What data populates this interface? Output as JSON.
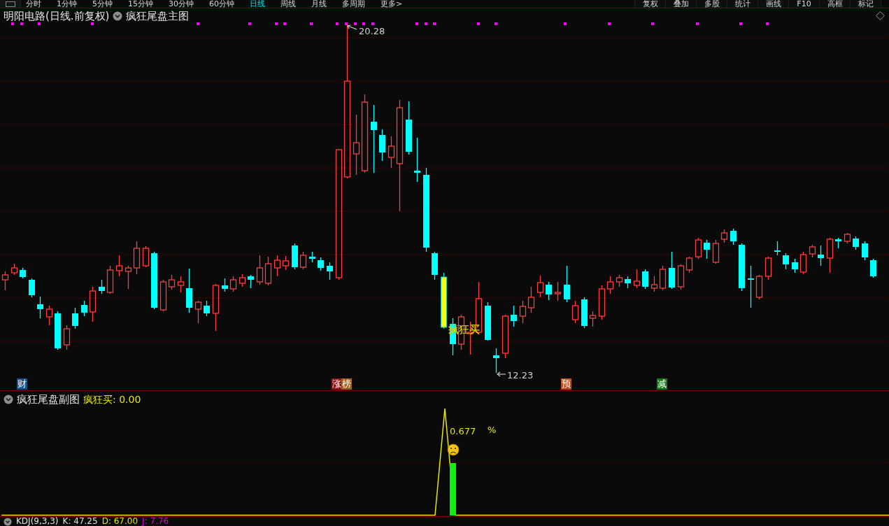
{
  "toolbar": {
    "periods": [
      {
        "label": "分时",
        "selected": false
      },
      {
        "label": "1分钟",
        "selected": false
      },
      {
        "label": "5分钟",
        "selected": false
      },
      {
        "label": "15分钟",
        "selected": false
      },
      {
        "label": "30分钟",
        "selected": false
      },
      {
        "label": "60分钟",
        "selected": false
      },
      {
        "label": "日线",
        "selected": true
      },
      {
        "label": "周线",
        "selected": false
      },
      {
        "label": "月线",
        "selected": false
      },
      {
        "label": "多周期",
        "selected": false
      },
      {
        "label": "更多>",
        "selected": false
      }
    ],
    "buttons": [
      "复权",
      "叠加",
      "多股",
      "统计",
      "画线",
      "F10",
      "高框",
      "标记"
    ]
  },
  "main_chart": {
    "title": "明阳电路(日线.前复权)",
    "indicator": "疯狂尾盘主图",
    "high_label": "20.28",
    "low_label": "12.23",
    "signal_label": "疯狂买",
    "events": [
      {
        "label": "财",
        "color": "#1c4c8c"
      },
      {
        "label": "涨",
        "color": "#8c1414"
      },
      {
        "label": "榜",
        "color": "#a0601c"
      },
      {
        "label": "预",
        "color": "#b4501c"
      },
      {
        "label": "减",
        "color": "#147814"
      }
    ]
  },
  "sub_chart": {
    "title": "疯狂尾盘副图",
    "reading": "疯狂买: 0.00",
    "value_label": "0.677",
    "unit_label": "%"
  },
  "kdj": {
    "name": "KDJ(9,3,3)",
    "values": [
      {
        "label": "K: 47.25",
        "color": "#e0e0e0"
      },
      {
        "label": "D: 67.00",
        "color": "#e8e800"
      },
      {
        "label": "J: 7.76",
        "color": "#e000e0"
      }
    ]
  }
}
